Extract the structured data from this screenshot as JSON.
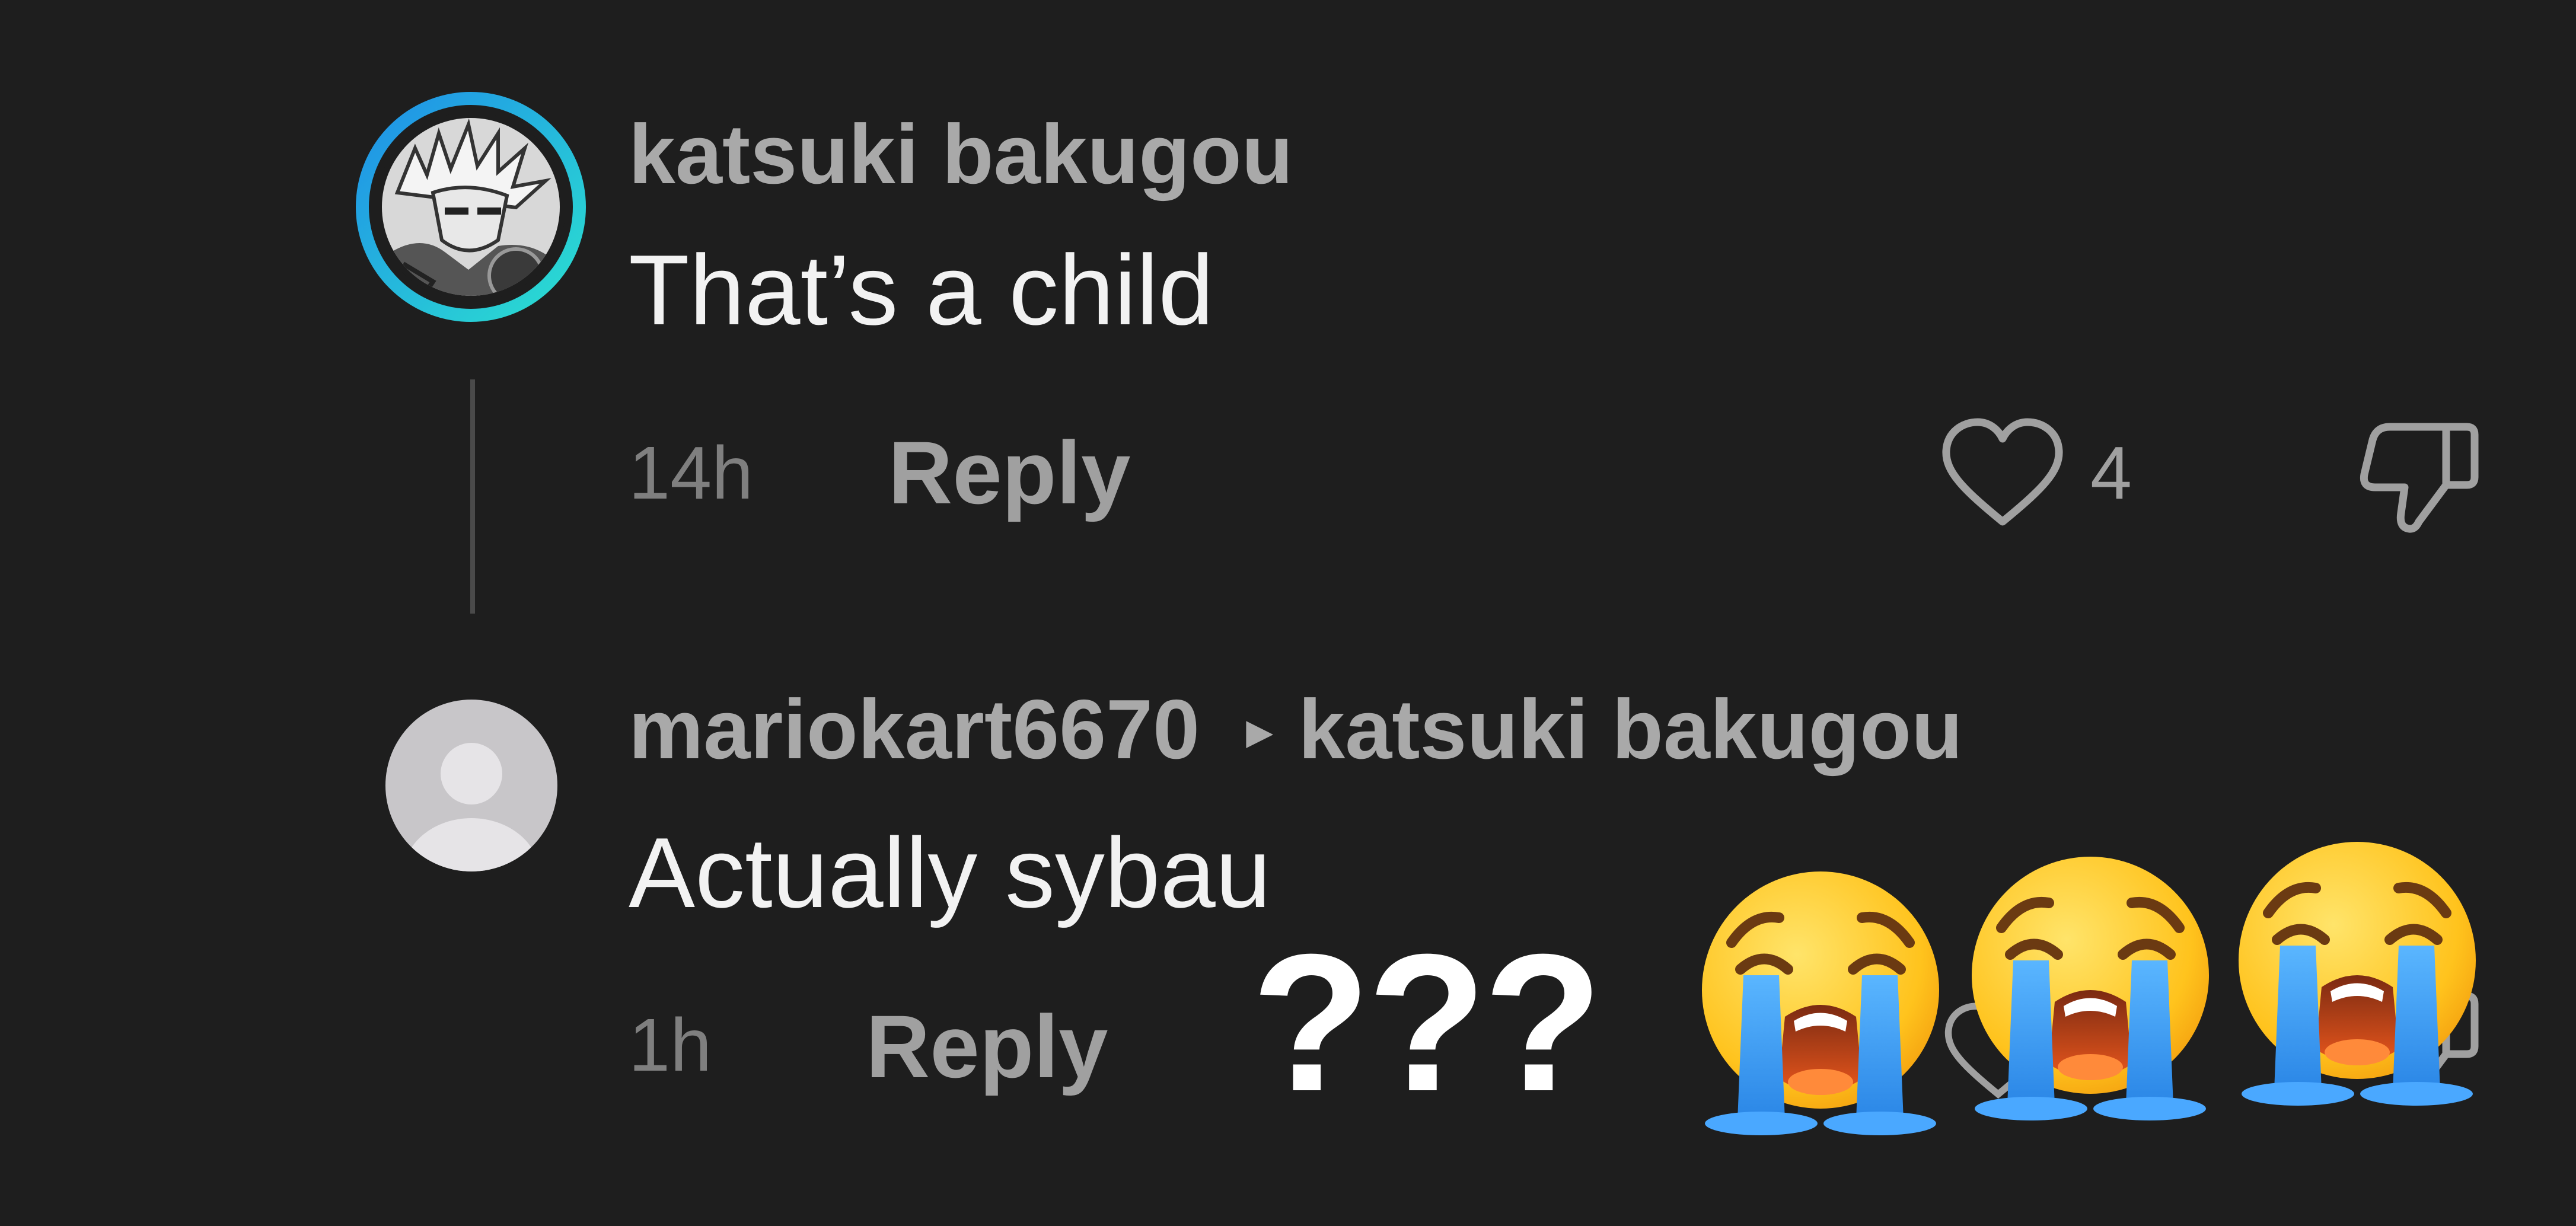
{
  "comments": [
    {
      "username": "katsuki bakugou",
      "text": "That’s a child",
      "timestamp": "14h",
      "reply_label": "Reply",
      "like_count": "4",
      "avatar_ring_color": "#22b8e6"
    },
    {
      "username": "mariokart6670",
      "reply_to_arrow": "▸",
      "reply_to": "katsuki bakugou",
      "text": "Actually sybau",
      "timestamp": "1h",
      "reply_label": "Reply"
    }
  ],
  "overlay": {
    "text": "???",
    "emoji_icons": [
      "loudly-crying-face-icon",
      "loudly-crying-face-icon",
      "loudly-crying-face-icon"
    ]
  },
  "colors": {
    "background": "#1e1e1e",
    "username": "#a9a9a9",
    "comment_text": "#f2f2f2",
    "meta_text": "#7f7f7f",
    "tear_blue": "#3a9df0",
    "emoji_yellow": "#ffc31d"
  }
}
